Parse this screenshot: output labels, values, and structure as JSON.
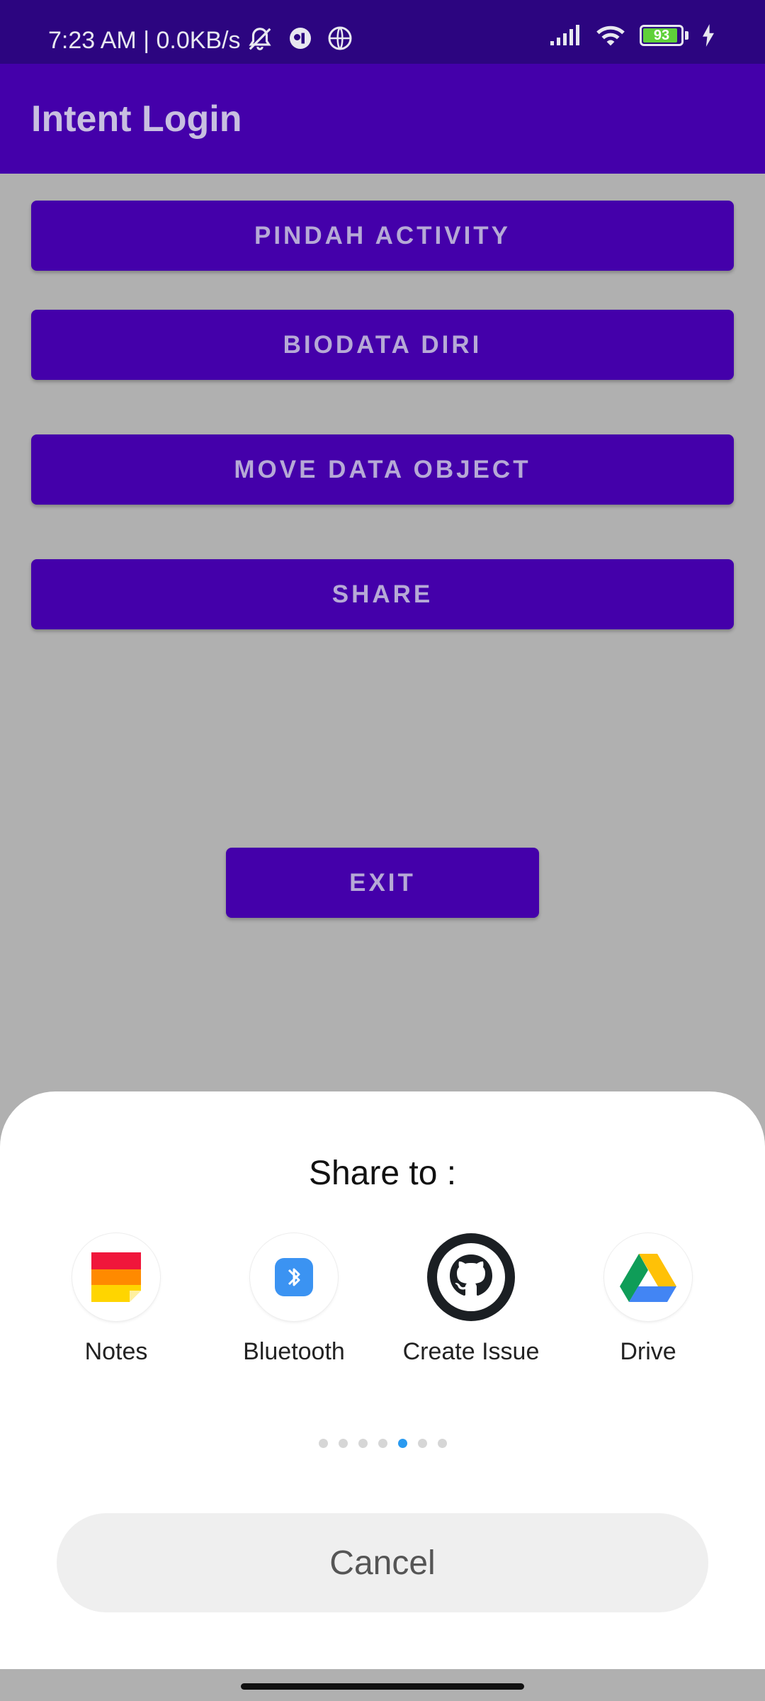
{
  "status": {
    "time_speed": "7:23 AM | 0.0KB/s",
    "battery": "93",
    "battery_level": 0.93
  },
  "appbar": {
    "title": "Intent Login"
  },
  "buttons": {
    "pindah": "PINDAH ACTIVITY",
    "biodata": "BIODATA DIRI",
    "move": "MOVE DATA OBJECT",
    "share": "SHARE",
    "exit": "EXIT"
  },
  "share_sheet": {
    "title": "Share to :",
    "apps": [
      {
        "label": "Notes",
        "icon": "notes-icon"
      },
      {
        "label": "Bluetooth",
        "icon": "bluetooth-icon"
      },
      {
        "label": "Create Issue",
        "icon": "github-icon"
      },
      {
        "label": "Drive",
        "icon": "drive-icon"
      }
    ],
    "page_count": 7,
    "active_page": 5,
    "cancel": "Cancel"
  },
  "colors": {
    "primary": "#4400aa",
    "status_bar": "#2c0580",
    "scrim": "#b0b0b0",
    "dot_active": "#2a9af0"
  }
}
